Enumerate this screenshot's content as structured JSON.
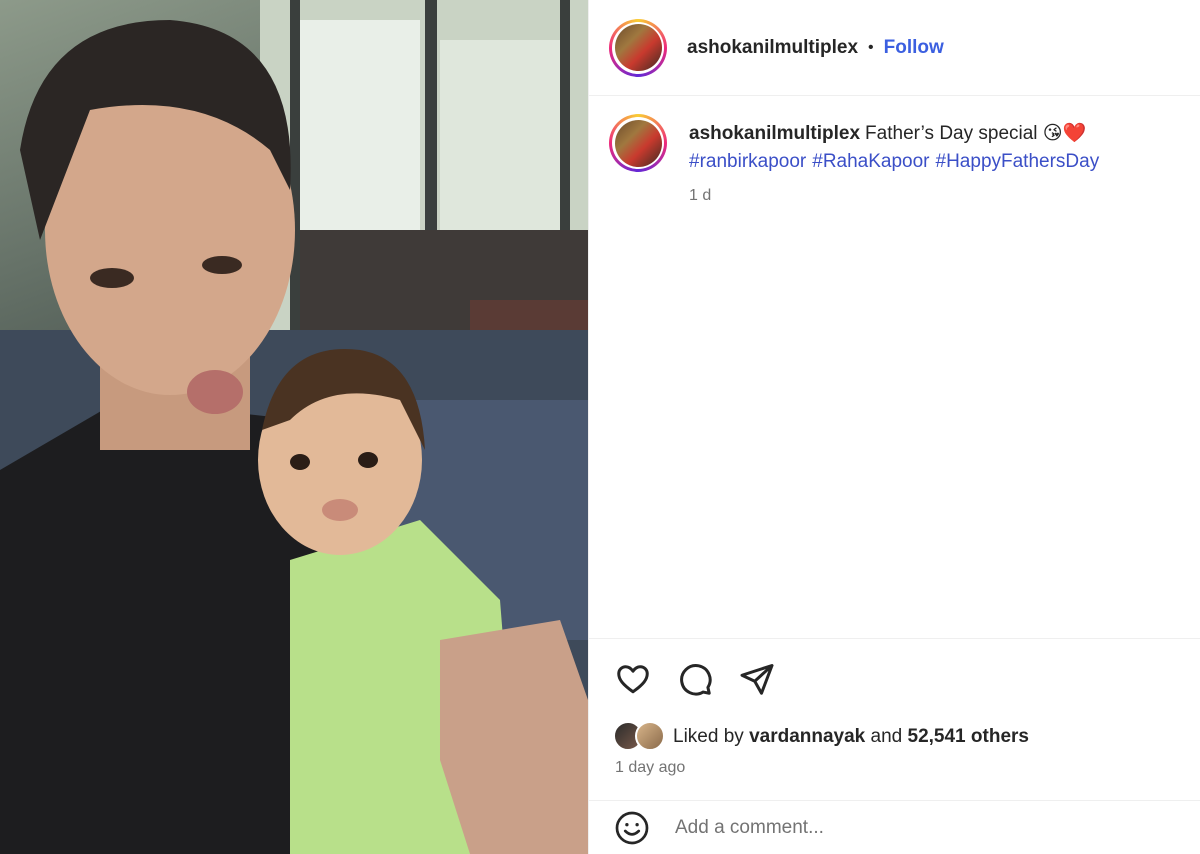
{
  "post": {
    "image_alt": "photo of a man and a child pouting",
    "account": "ashokanilmultiplex",
    "separator": "•",
    "follow_label": "Follow",
    "caption_username": "ashokanilmultiplex",
    "caption_text": "Father’s Day special 😘❤️",
    "hashtags": [
      "#ranbirkapoor",
      "#RahaKapoor",
      "#HappyFathersDay"
    ],
    "relative_time": "1 d"
  },
  "actions": {
    "like_icon": "heart-icon",
    "comment_icon": "speech-bubble-icon",
    "share_icon": "paper-plane-icon"
  },
  "likes": {
    "prefix": "Liked by",
    "user": "vardannayak",
    "conjunction": "and",
    "others": "52,541 others"
  },
  "posted_ago": "1 day ago",
  "comment": {
    "emoji_icon": "smiley-icon",
    "placeholder": "Add a comment..."
  },
  "colors": {
    "link_blue": "#3b5fe0",
    "hashtag_blue": "#3b4fc7",
    "muted": "#737373",
    "text": "#262626",
    "divider": "#efefef"
  }
}
